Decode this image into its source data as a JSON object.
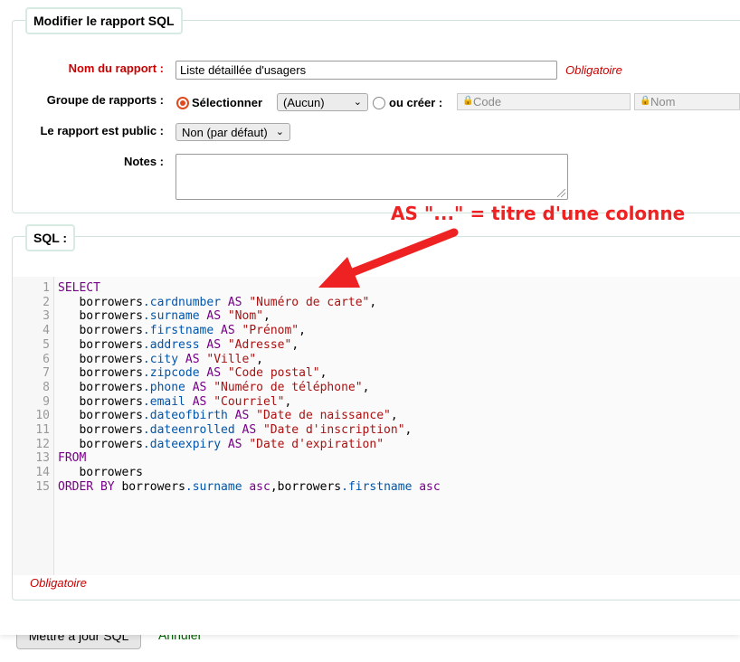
{
  "report_form": {
    "legend": "Modifier le rapport SQL",
    "name_label": "Nom du rapport :",
    "name_value": "Liste détaillée d'usagers",
    "required_hint": "Obligatoire",
    "group_label": "Groupe de rapports :",
    "group_select_radio_label": "Sélectionner",
    "group_select_value": "(Aucun)",
    "group_create_radio_label": "ou créer :",
    "code_placeholder": "Code",
    "name_placeholder": "Nom",
    "public_label": "Le rapport est public :",
    "public_value": "Non (par défaut)",
    "notes_label": "Notes :",
    "notes_value": ""
  },
  "sql_section": {
    "legend": "SQL :",
    "required_hint": "Obligatoire",
    "line_numbers": [
      "1",
      "2",
      "3",
      "4",
      "5",
      "6",
      "7",
      "8",
      "9",
      "10",
      "11",
      "12",
      "13",
      "14",
      "15"
    ],
    "code_lines": [
      [
        {
          "t": "SELECT",
          "c": "kw"
        }
      ],
      [
        {
          "t": "   borrowers"
        },
        {
          "t": ".cardnumber",
          "c": "prop"
        },
        {
          "t": " AS ",
          "c": "kw"
        },
        {
          "t": "\"Numéro de carte\"",
          "c": "str"
        },
        {
          "t": ","
        }
      ],
      [
        {
          "t": "   borrowers"
        },
        {
          "t": ".surname",
          "c": "prop"
        },
        {
          "t": " AS ",
          "c": "kw"
        },
        {
          "t": "\"Nom\"",
          "c": "str"
        },
        {
          "t": ","
        }
      ],
      [
        {
          "t": "   borrowers"
        },
        {
          "t": ".firstname",
          "c": "prop"
        },
        {
          "t": " AS ",
          "c": "kw"
        },
        {
          "t": "\"Prénom\"",
          "c": "str"
        },
        {
          "t": ","
        }
      ],
      [
        {
          "t": "   borrowers"
        },
        {
          "t": ".address",
          "c": "prop"
        },
        {
          "t": " AS ",
          "c": "kw"
        },
        {
          "t": "\"Adresse\"",
          "c": "str"
        },
        {
          "t": ","
        }
      ],
      [
        {
          "t": "   borrowers"
        },
        {
          "t": ".city",
          "c": "prop"
        },
        {
          "t": " AS ",
          "c": "kw"
        },
        {
          "t": "\"Ville\"",
          "c": "str"
        },
        {
          "t": ","
        }
      ],
      [
        {
          "t": "   borrowers"
        },
        {
          "t": ".zipcode",
          "c": "prop"
        },
        {
          "t": " AS ",
          "c": "kw"
        },
        {
          "t": "\"Code postal\"",
          "c": "str"
        },
        {
          "t": ","
        }
      ],
      [
        {
          "t": "   borrowers"
        },
        {
          "t": ".phone",
          "c": "prop"
        },
        {
          "t": " AS ",
          "c": "kw"
        },
        {
          "t": "\"Numéro de téléphone\"",
          "c": "str"
        },
        {
          "t": ","
        }
      ],
      [
        {
          "t": "   borrowers"
        },
        {
          "t": ".email",
          "c": "prop"
        },
        {
          "t": " AS ",
          "c": "kw"
        },
        {
          "t": "\"Courriel\"",
          "c": "str"
        },
        {
          "t": ","
        }
      ],
      [
        {
          "t": "   borrowers"
        },
        {
          "t": ".dateofbirth",
          "c": "prop"
        },
        {
          "t": " AS ",
          "c": "kw"
        },
        {
          "t": "\"Date de naissance\"",
          "c": "str"
        },
        {
          "t": ","
        }
      ],
      [
        {
          "t": "   borrowers"
        },
        {
          "t": ".dateenrolled",
          "c": "prop"
        },
        {
          "t": " AS ",
          "c": "kw"
        },
        {
          "t": "\"Date d'inscription\"",
          "c": "str"
        },
        {
          "t": ","
        }
      ],
      [
        {
          "t": "   borrowers"
        },
        {
          "t": ".dateexpiry",
          "c": "prop"
        },
        {
          "t": " AS ",
          "c": "kw"
        },
        {
          "t": "\"Date d'expiration\"",
          "c": "str"
        }
      ],
      [
        {
          "t": "FROM",
          "c": "kw"
        }
      ],
      [
        {
          "t": "   borrowers"
        }
      ],
      [
        {
          "t": "ORDER BY",
          "c": "kw"
        },
        {
          "t": " borrowers"
        },
        {
          "t": ".surname",
          "c": "prop"
        },
        {
          "t": " asc",
          "c": "kw"
        },
        {
          "t": ",borrowers"
        },
        {
          "t": ".firstname",
          "c": "prop"
        },
        {
          "t": " asc",
          "c": "kw"
        }
      ]
    ]
  },
  "annotation": {
    "text": "AS \"...\" = titre d'une colonne",
    "color": "#ee2222"
  },
  "actions": {
    "submit_label": "Mettre à jour SQL",
    "cancel_label": "Annuler"
  },
  "colors": {
    "required": "#cc0000",
    "keyword": "#770088",
    "property": "#0055aa",
    "string": "#aa1111",
    "radio_accent": "#e04a1f"
  },
  "icons": {
    "chevron": "chevron-down-icon",
    "lock": "lock-icon",
    "annotation_arrow": "arrow-icon"
  }
}
